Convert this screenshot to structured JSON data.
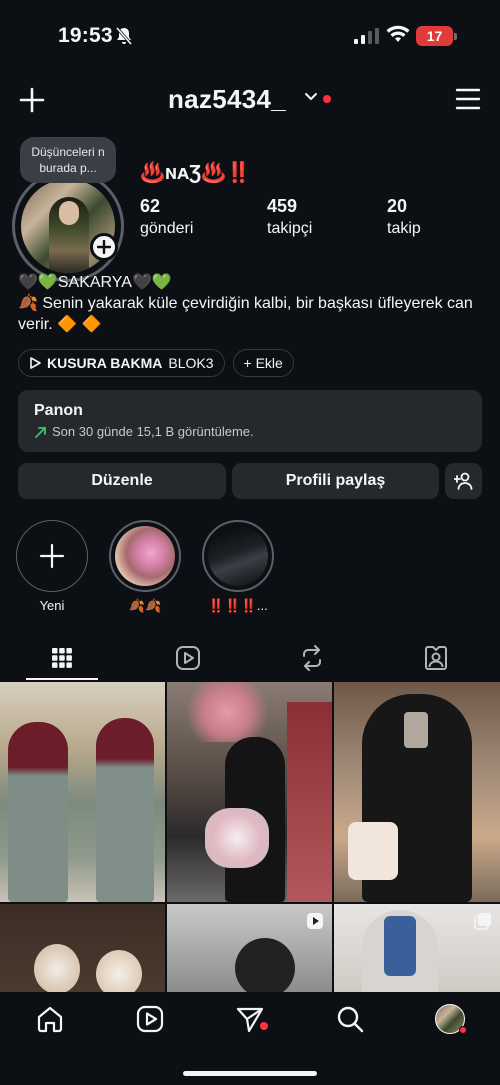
{
  "status_bar": {
    "time": "19:53",
    "battery": "17"
  },
  "header": {
    "username": "naz5434_"
  },
  "profile": {
    "note": "Düşünceleri n burada p...",
    "display_name": "♨️ɴᴀƷ♨️‼️",
    "stats": [
      {
        "value": "62",
        "label": "gönderi"
      },
      {
        "value": "459",
        "label": "takipçi"
      },
      {
        "value": "20",
        "label": "takip"
      }
    ],
    "bio_line1": "🖤💚SAKARYA🖤💚",
    "bio_line2": "🍂 Senin yakarak küle çevirdiğin kalbi, bir başkası üfleyerek can verir. 🔶 🔶"
  },
  "chips": {
    "music_title": "KUSURA BAKMA",
    "music_artist": "BLOK3",
    "add_label": "+ Ekle"
  },
  "dashboard": {
    "title": "Panon",
    "subtitle": "Son 30 günde 15,1 B görüntüleme."
  },
  "buttons": {
    "edit": "Düzenle",
    "share": "Profili paylaş"
  },
  "highlights": [
    {
      "label": "Yeni"
    },
    {
      "label": "🍂🍂"
    },
    {
      "label": "‼️‼️‼️..."
    }
  ],
  "colors": {
    "background": "#0c1014",
    "surface": "#25292e",
    "notification": "#ff3040",
    "battery": "#e03a3a"
  }
}
